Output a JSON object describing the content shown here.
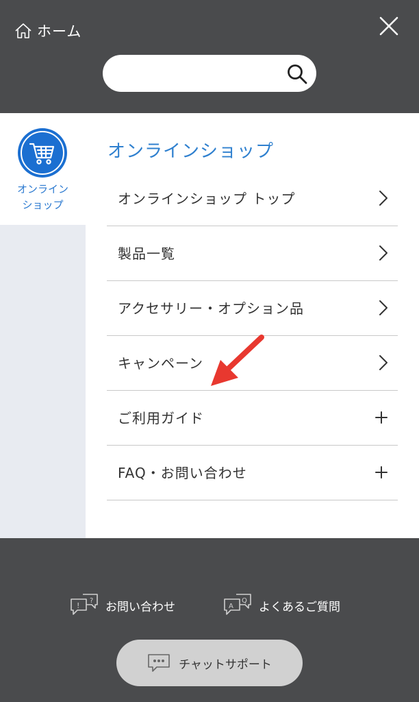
{
  "header": {
    "home_label": "ホーム",
    "search": {
      "value": "",
      "placeholder": ""
    }
  },
  "sidebar": {
    "active_category": {
      "label_line1": "オンライン",
      "label_line2": "ショップ",
      "icon": "cart-icon"
    }
  },
  "main": {
    "section_title": "オンラインショップ",
    "menu_items": [
      {
        "label": "オンラインショップ トップ",
        "icon": "chevron-right-icon"
      },
      {
        "label": "製品一覧",
        "icon": "chevron-right-icon"
      },
      {
        "label": "アクセサリー・オプション品",
        "icon": "chevron-right-icon"
      },
      {
        "label": "キャンペーン",
        "icon": "chevron-right-icon"
      },
      {
        "label": "ご利用ガイド",
        "icon": "plus-icon"
      },
      {
        "label": "FAQ・お問い合わせ",
        "icon": "plus-icon"
      }
    ]
  },
  "footer": {
    "contact_label": "お問い合わせ",
    "faq_label": "よくあるご質問",
    "chat_label": "チャットサポート"
  },
  "colors": {
    "header_bg": "#4a4b4d",
    "accent_blue": "#2f80cf",
    "cart_circle": "#1b6fd1",
    "annotation_arrow": "#e8382f",
    "sidebar_bg": "#e8ebf1"
  }
}
